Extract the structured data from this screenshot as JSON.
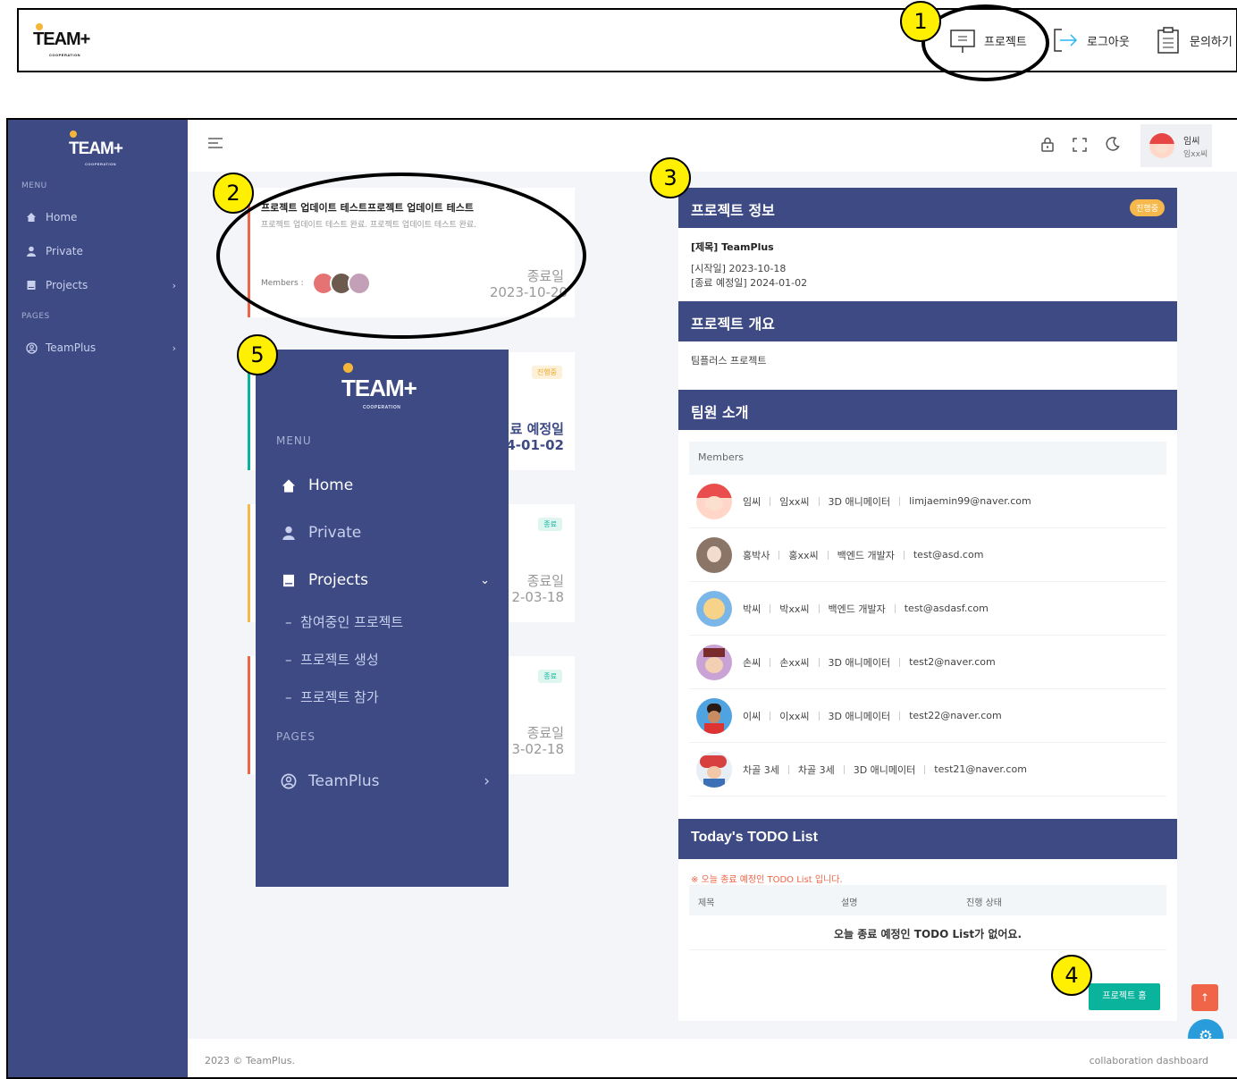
{
  "top_nav": {
    "logo_text": "TEAM+",
    "logo_sub": "COOPERATION",
    "items": [
      {
        "label": "프로젝트",
        "icon": "presentation-board-icon"
      },
      {
        "label": "로그아웃",
        "icon": "logout-arrow-icon"
      },
      {
        "label": "문의하기",
        "icon": "clipboard-icon"
      }
    ]
  },
  "callouts": [
    "1",
    "2",
    "3",
    "4",
    "5"
  ],
  "sidebar": {
    "logo_text": "TEAM+",
    "logo_sub": "COOPERATION",
    "menu_label": "MENU",
    "pages_label": "PAGES",
    "items": [
      {
        "label": "Home",
        "icon": "home-icon"
      },
      {
        "label": "Private",
        "icon": "user-icon"
      },
      {
        "label": "Projects",
        "icon": "book-icon"
      },
      {
        "label": "TeamPlus",
        "icon": "user-circle-icon"
      }
    ]
  },
  "header": {
    "user_name": "임씨",
    "user_sub": "임xx씨"
  },
  "project_cards": [
    {
      "title": "프로젝트 업데이트 테스트프로젝트 업데이트 테스트",
      "desc": "프로젝트 업데이트 테스트 완료. 프로젝트 업데이트 테스트 완료.",
      "members_label": "Members :",
      "date_label": "종료일",
      "date": "2023-10-20",
      "accent": "#f06548"
    },
    {
      "badge": "진행중",
      "date_label": "료 예정일",
      "date": "4-01-02",
      "accent": "#0ab39c"
    },
    {
      "badge": "종료",
      "date_label": "종료일",
      "date": "2-03-18",
      "accent": "#f7b84b"
    },
    {
      "badge": "종료",
      "date_label": "종료일",
      "date": "3-02-18",
      "accent": "#f06548"
    }
  ],
  "flyout": {
    "logo_text": "TEAM+",
    "logo_sub": "COOPERATION",
    "menu_label": "MENU",
    "pages_label": "PAGES",
    "items": [
      {
        "label": "Home"
      },
      {
        "label": "Private"
      },
      {
        "label": "Projects"
      },
      {
        "label": "TeamPlus"
      }
    ],
    "sub_items": [
      "참여중인 프로젝트",
      "프로젝트 생성",
      "프로젝트 참가"
    ]
  },
  "project_info": {
    "title": "프로젝트 정보",
    "status_badge": "진행중",
    "name_line": "[제목] TeamPlus",
    "start_line": "[시작일] 2023-10-18",
    "end_line": "[종료 예정일] 2024-01-02"
  },
  "overview": {
    "title": "프로젝트 개요",
    "text": "팀플러스 프로젝트"
  },
  "team": {
    "title": "팀원 소개",
    "members_header": "Members",
    "members": [
      {
        "nick": "임씨",
        "name": "임xx씨",
        "role": "3D 애니메이터",
        "email": "limjaemin99@naver.com"
      },
      {
        "nick": "홍박사",
        "name": "홍xx씨",
        "role": "백엔드 개발자",
        "email": "test@asd.com"
      },
      {
        "nick": "박씨",
        "name": "박xx씨",
        "role": "백엔드 개발자",
        "email": "test@asdasf.com"
      },
      {
        "nick": "손씨",
        "name": "손xx씨",
        "role": "3D 애니메이터",
        "email": "test2@naver.com"
      },
      {
        "nick": "이씨",
        "name": "이xx씨",
        "role": "3D 애니메이터",
        "email": "test22@naver.com"
      },
      {
        "nick": "차골 3세",
        "name": "차골 3세",
        "role": "3D 애니메이터",
        "email": "test21@naver.com"
      }
    ]
  },
  "todo": {
    "title": "Today's TODO List",
    "notice": "※ 오늘 종료 예정인 TODO List 입니다.",
    "columns": [
      "제목",
      "설명",
      "진행 상태"
    ],
    "empty": "오늘 종료 예정인 TODO List가 없어요.",
    "home_button": "프로젝트 홈"
  },
  "footer": {
    "left": "2023 © TeamPlus.",
    "right": "collaboration dashboard"
  }
}
